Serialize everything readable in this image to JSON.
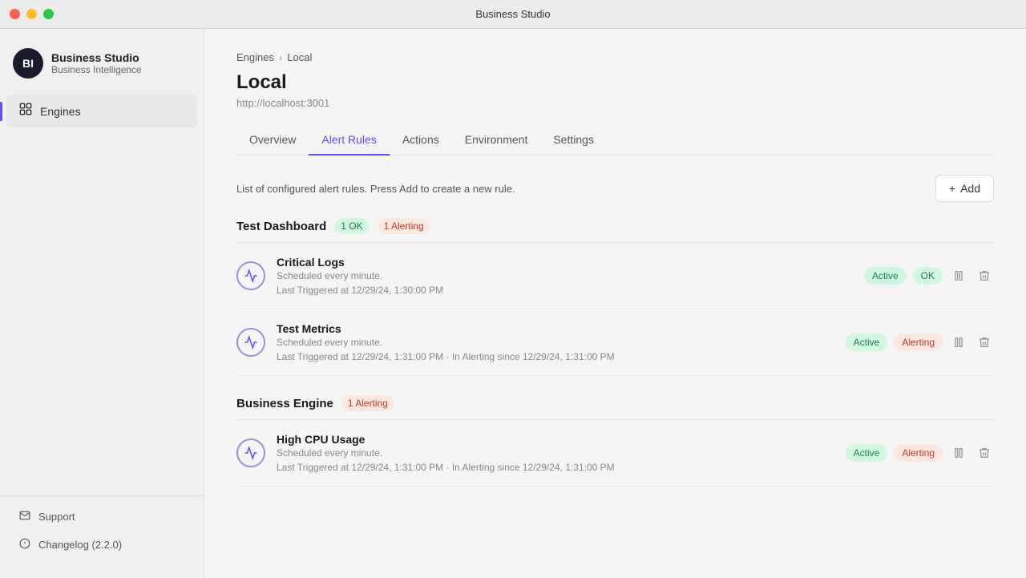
{
  "titlebar": {
    "title": "Business Studio"
  },
  "sidebar": {
    "app_name": "Business Studio",
    "app_sub": "Business Intelligence",
    "logo_text": "BI",
    "nav_items": [
      {
        "id": "engines",
        "label": "Engines",
        "active": true
      }
    ],
    "footer_items": [
      {
        "id": "support",
        "label": "Support"
      },
      {
        "id": "changelog",
        "label": "Changelog (2.2.0)"
      }
    ]
  },
  "breadcrumb": {
    "parent": "Engines",
    "separator": ">",
    "current": "Local"
  },
  "page": {
    "title": "Local",
    "subtitle": "http://localhost:3001"
  },
  "tabs": [
    {
      "id": "overview",
      "label": "Overview",
      "active": false
    },
    {
      "id": "alert-rules",
      "label": "Alert Rules",
      "active": true
    },
    {
      "id": "actions",
      "label": "Actions",
      "active": false
    },
    {
      "id": "environment",
      "label": "Environment",
      "active": false
    },
    {
      "id": "settings",
      "label": "Settings",
      "active": false
    }
  ],
  "alert_rules": {
    "description": "List of configured alert rules. Press Add to create a new rule.",
    "add_label": "+ Add",
    "groups": [
      {
        "id": "test-dashboard",
        "name": "Test Dashboard",
        "badges": [
          {
            "label": "1 OK",
            "type": "ok"
          },
          {
            "label": "1 Alerting",
            "type": "alerting"
          }
        ],
        "rules": [
          {
            "id": "critical-logs",
            "name": "Critical Logs",
            "schedule": "Scheduled every minute.",
            "trigger": "Last Triggered at 12/29/24, 1:30:00 PM",
            "alerting_info": null,
            "status_active": "Active",
            "status_state": "OK"
          },
          {
            "id": "test-metrics",
            "name": "Test Metrics",
            "schedule": "Scheduled every minute.",
            "trigger": "Last Triggered at 12/29/24, 1:31:00 PM",
            "alerting_info": "In Alerting since 12/29/24, 1:31:00 PM",
            "status_active": "Active",
            "status_state": "Alerting"
          }
        ]
      },
      {
        "id": "business-engine",
        "name": "Business Engine",
        "badges": [
          {
            "label": "1 Alerting",
            "type": "alerting"
          }
        ],
        "rules": [
          {
            "id": "high-cpu-usage",
            "name": "High CPU Usage",
            "schedule": "Scheduled every minute.",
            "trigger": "Last Triggered at 12/29/24, 1:31:00 PM",
            "alerting_info": "In Alerting since 12/29/24, 1:31:00 PM",
            "status_active": "Active",
            "status_state": "Alerting"
          }
        ]
      }
    ]
  }
}
